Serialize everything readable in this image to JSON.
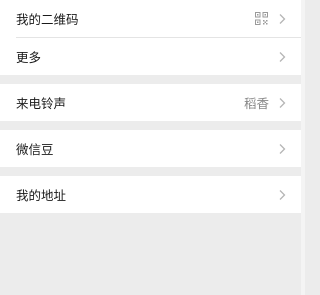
{
  "menu": {
    "my_qr_code": {
      "label": "我的二维码",
      "icon": "qr-code-icon"
    },
    "more": {
      "label": "更多"
    },
    "ringtone": {
      "label": "来电铃声",
      "value": "稻香"
    },
    "wechat_beans": {
      "label": "微信豆"
    },
    "my_address": {
      "label": "我的地址"
    }
  },
  "colors": {
    "background": "#ececec",
    "row_background": "#ffffff",
    "text_primary": "#1a1a1a",
    "text_secondary": "#888888",
    "chevron": "#b5b5b5"
  }
}
